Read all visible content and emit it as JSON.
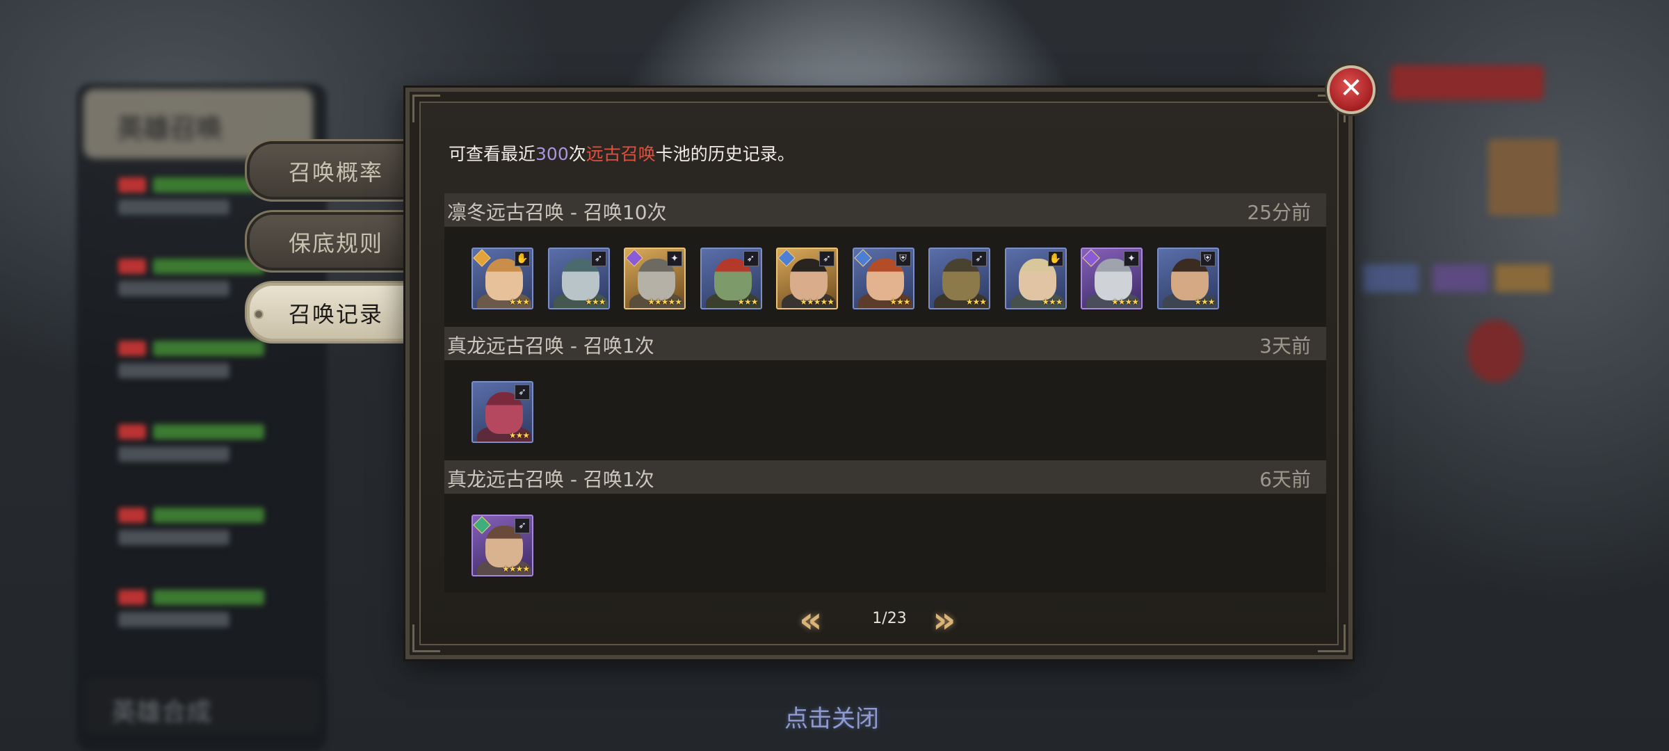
{
  "tabs": [
    {
      "label": "召唤概率",
      "active": false
    },
    {
      "label": "保底规则",
      "active": false
    },
    {
      "label": "召唤记录",
      "active": true
    }
  ],
  "dialog": {
    "intro_prefix": "可查看最近",
    "intro_count": "300",
    "intro_mid": "次",
    "intro_pool": "远古召唤",
    "intro_suffix": "卡池的历史记录。",
    "records": [
      {
        "title": "凛冬远古召唤 - 召唤10次",
        "time": "25分前",
        "heroes": [
          {
            "rarity": "blue",
            "class_icon": "priest-icon",
            "element_icon": "holy-icon",
            "stars": 3,
            "skin": "#e6c19a",
            "hair": "#c98f4a",
            "outfit": "#6b5a49"
          },
          {
            "rarity": "blue",
            "class_icon": "archer-icon",
            "element_icon": "",
            "stars": 3,
            "skin": "#b9c4c8",
            "hair": "#4b6a6e",
            "outfit": "#44584f"
          },
          {
            "rarity": "gold",
            "class_icon": "mage-icon",
            "element_icon": "arcane-icon",
            "stars": 5,
            "skin": "#b5b1a7",
            "hair": "#6d6a62",
            "outfit": "#5a4d3b"
          },
          {
            "rarity": "blue",
            "class_icon": "archer-icon",
            "element_icon": "",
            "stars": 3,
            "skin": "#7d9a6a",
            "hair": "#b5392b",
            "outfit": "#3a3f2e"
          },
          {
            "rarity": "gold",
            "class_icon": "archer-icon",
            "element_icon": "frost-icon",
            "stars": 5,
            "skin": "#d9ad8c",
            "hair": "#2a2420",
            "outfit": "#3a3430"
          },
          {
            "rarity": "blue",
            "class_icon": "warrior-icon",
            "element_icon": "frost-icon",
            "stars": 3,
            "skin": "#e3b38f",
            "hair": "#b34d27",
            "outfit": "#5c3c2a"
          },
          {
            "rarity": "blue",
            "class_icon": "archer-icon",
            "element_icon": "",
            "stars": 3,
            "skin": "#8c7a4a",
            "hair": "#4a4230",
            "outfit": "#3b352a"
          },
          {
            "rarity": "blue",
            "class_icon": "priest-icon",
            "element_icon": "",
            "stars": 3,
            "skin": "#e0c4a3",
            "hair": "#d8c79a",
            "outfit": "#46504f"
          },
          {
            "rarity": "purple",
            "class_icon": "mage-icon",
            "element_icon": "arcane-icon",
            "stars": 4,
            "skin": "#cfd2d6",
            "hair": "#9ea3ad",
            "outfit": "#4a4d5a"
          },
          {
            "rarity": "blue",
            "class_icon": "warrior-icon",
            "element_icon": "",
            "stars": 3,
            "skin": "#d6a985",
            "hair": "#3b2c22",
            "outfit": "#3d4650"
          }
        ]
      },
      {
        "title": "真龙远古召唤 - 召唤1次",
        "time": "3天前",
        "heroes": [
          {
            "rarity": "blue",
            "class_icon": "archer-icon",
            "element_icon": "",
            "stars": 3,
            "skin": "#b5475f",
            "hair": "#7a2a3c",
            "outfit": "#5c2a38"
          }
        ]
      },
      {
        "title": "真龙远古召唤 - 召唤1次",
        "time": "6天前",
        "heroes": [
          {
            "rarity": "purple",
            "class_icon": "archer-icon",
            "element_icon": "nature-icon",
            "stars": 4,
            "skin": "#d9b28f",
            "hair": "#6a4a3a",
            "outfit": "#5a4a4a"
          }
        ]
      }
    ],
    "pager": {
      "text": "1/23",
      "prev_icon": "double-chevron-left-icon",
      "next_icon": "double-chevron-right-icon"
    }
  },
  "close_icon": "close-icon",
  "tap_to_close": "点击关闭",
  "background": {
    "left_header": "英雄召唤",
    "left_bottom": "英雄合成"
  },
  "colors": {
    "intro_count": "#a996e0",
    "intro_pool": "#e0503f",
    "pager_arrow": "#d8b479",
    "close_button": "#c62a2d"
  }
}
